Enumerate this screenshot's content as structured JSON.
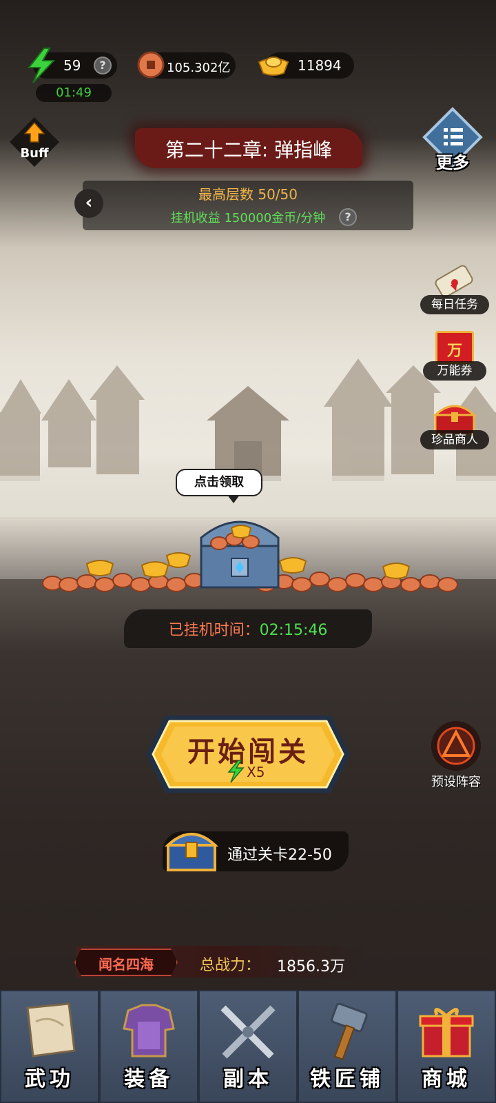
{
  "resources": {
    "energy": "59",
    "energy_timer": "01:49",
    "coins": "105.302亿",
    "gold": "11894",
    "help_glyph": "?"
  },
  "buff": {
    "label": "Buff"
  },
  "more": {
    "label": "更多"
  },
  "chapter": {
    "title": "第二十二章: 弹指峰",
    "floor_text": "最高层数 50/50",
    "income_text": "挂机收益 150000金币/分钟",
    "back_glyph": "‹"
  },
  "side_buttons": [
    {
      "label": "每日任务",
      "icon": "scroll-icon"
    },
    {
      "label": "万能券",
      "icon": "voucher-icon",
      "glyph": "万"
    },
    {
      "label": "珍品商人",
      "icon": "treasure-chest-icon"
    }
  ],
  "idle": {
    "bubble": "点击领取",
    "label": "已挂机时间：",
    "time": "02:15:46"
  },
  "start": {
    "label": "开始闯关",
    "cost": "X5"
  },
  "preset": {
    "label": "预设阵容"
  },
  "pass_reward": {
    "label": "通过关卡22-50"
  },
  "power": {
    "title_badge": "闻名四海",
    "label": "总战力：",
    "value": "1856.3万"
  },
  "nav": [
    {
      "label": "武功",
      "icon": "manual-scroll-icon"
    },
    {
      "label": "装备",
      "icon": "armor-icon"
    },
    {
      "label": "副本",
      "icon": "crossed-swords-icon"
    },
    {
      "label": "铁匠铺",
      "icon": "hammer-icon"
    },
    {
      "label": "商城",
      "icon": "gift-box-icon"
    }
  ],
  "colors": {
    "energy_green": "#3fd43f",
    "floor_orange": "#f0b54a",
    "income_green": "#5ee05a",
    "idle_red": "#ff7a52",
    "button_gold": "#f6b92b",
    "nav_blue": "#4e5d74"
  }
}
